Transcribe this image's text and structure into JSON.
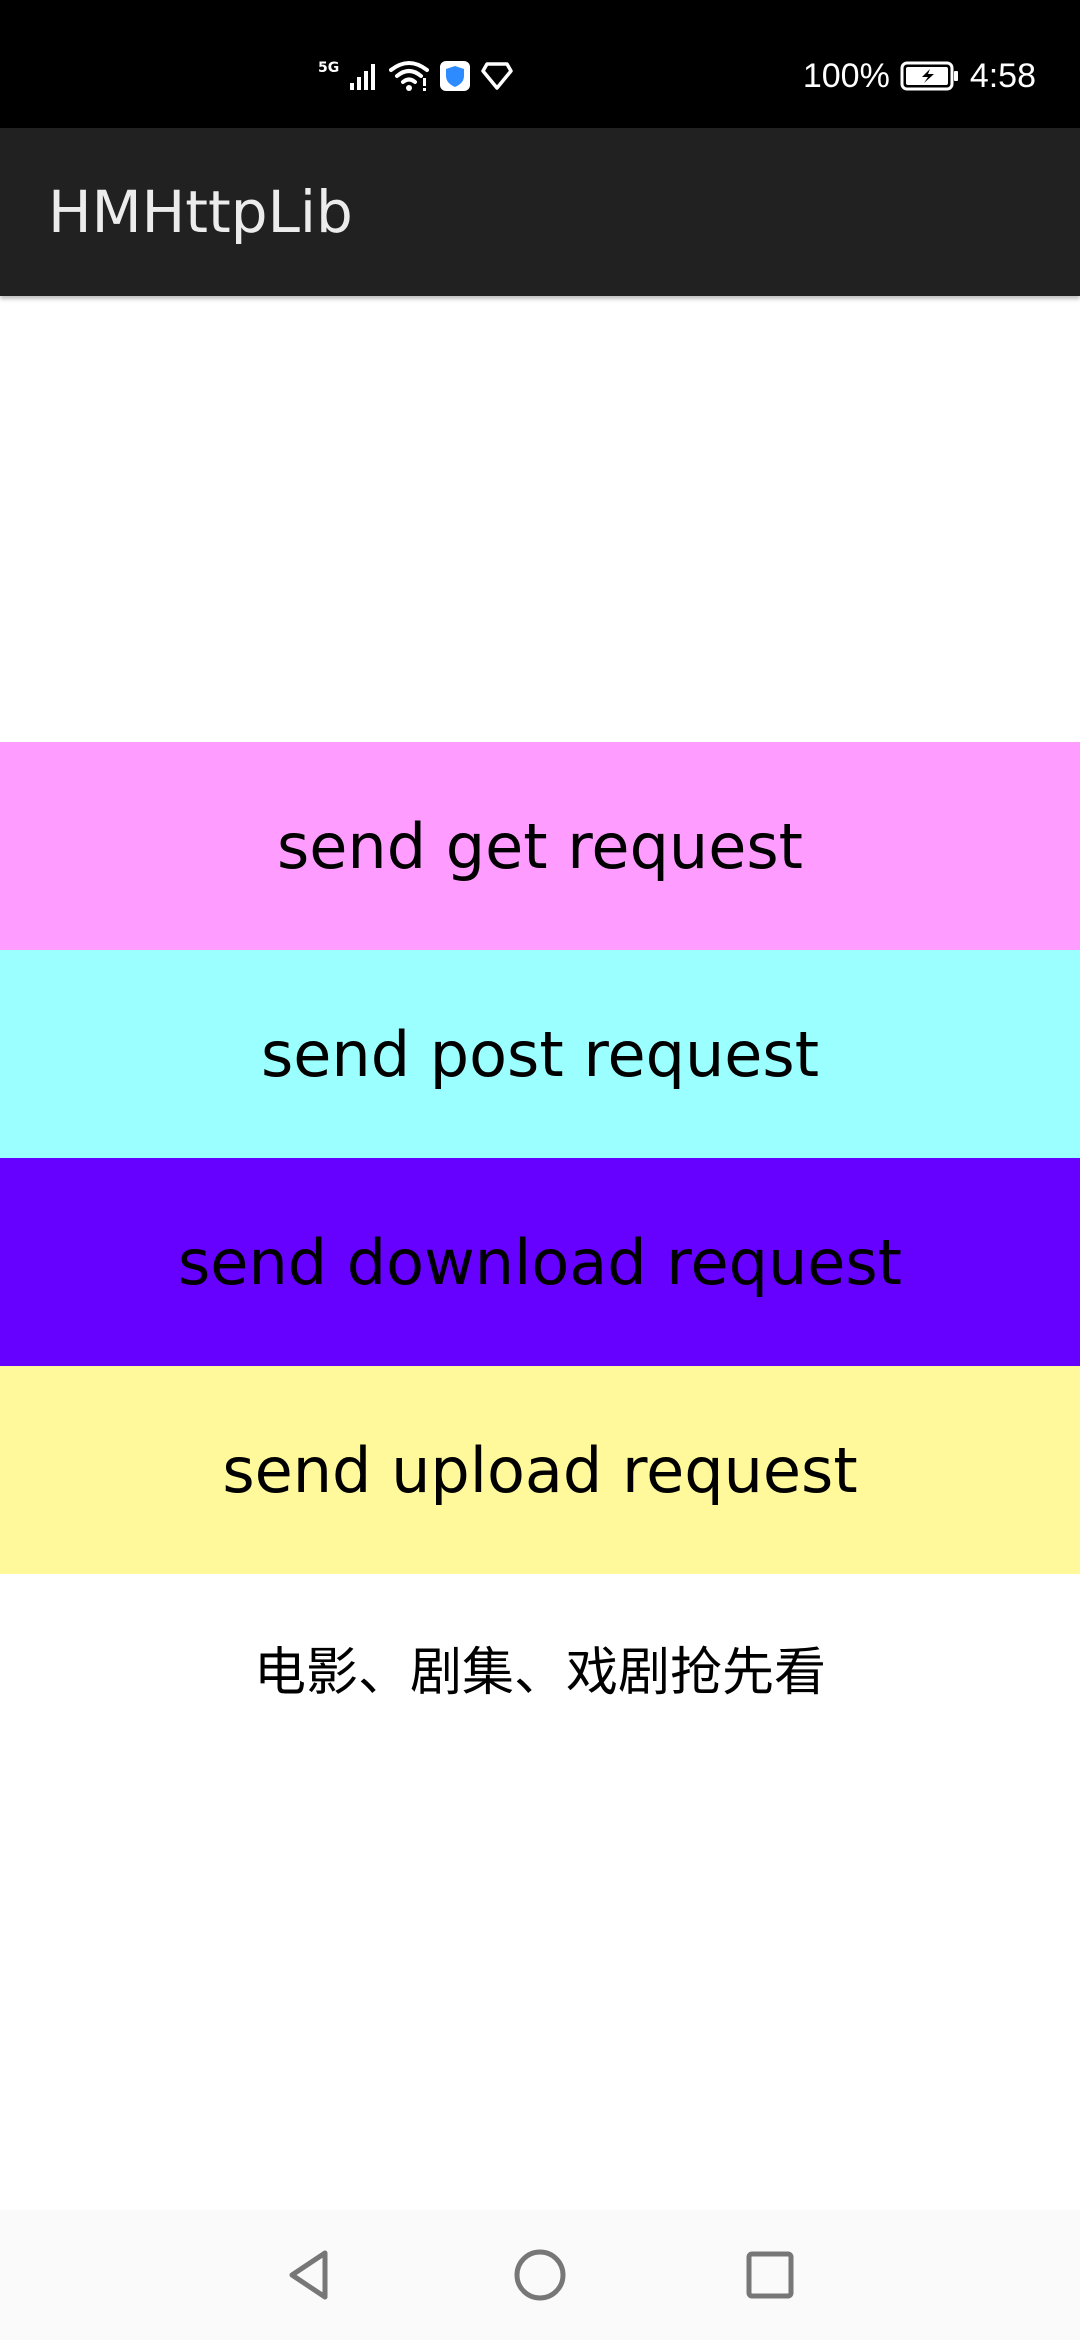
{
  "status_bar": {
    "network_label": "5G",
    "battery": "100%",
    "time": "4:58",
    "icons": [
      "signal-icon",
      "wifi-icon",
      "shield-icon",
      "diamond-icon",
      "battery-icon"
    ]
  },
  "app_bar": {
    "title": "HMHttpLib",
    "background": "#212121"
  },
  "buttons": [
    {
      "label": "send get request",
      "color": "#ff9cff"
    },
    {
      "label": "send post request",
      "color": "#9bffff"
    },
    {
      "label": "send download request",
      "color": "#6600ff"
    },
    {
      "label": "send upload request",
      "color": "#fff99b"
    }
  ],
  "caption": "电影、剧集、戏剧抢先看",
  "nav_bar": {
    "icons": [
      "back-icon",
      "home-icon",
      "recents-icon"
    ]
  }
}
